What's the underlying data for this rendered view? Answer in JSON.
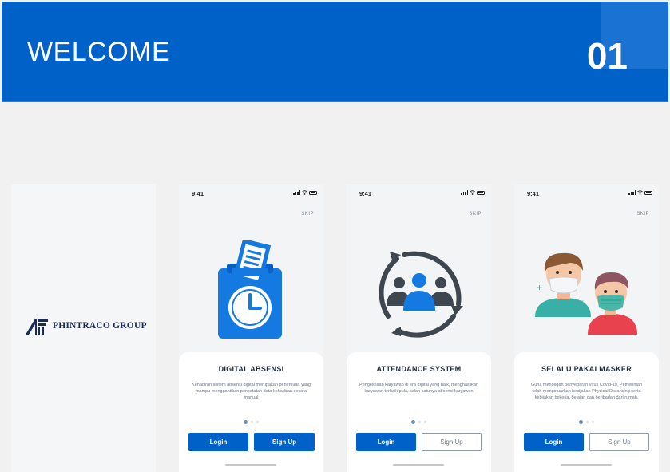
{
  "banner": {
    "title": "WELCOME",
    "number": "01"
  },
  "splash": {
    "brand": "PHINTRACO GROUP"
  },
  "screens": [
    {
      "time": "9:41",
      "skip": "SKIP",
      "title": "DIGITAL ABSENSI",
      "desc": "Kehadiran sistem absensi digital merupakan penemuan yang mampu menggantikan pencatatan data kehadiran secara manual",
      "login": "Login",
      "signup": "Sign Up",
      "illustration": "clock-card-icon"
    },
    {
      "time": "9:41",
      "skip": "SKIP",
      "title": "ATTENDANCE SYSTEM",
      "desc": "Pengelolaan karyawan di era digital yang baik, menghasilkan karyawan terbaik pula, salah satunya absensi karyawan",
      "login": "Login",
      "signup": "Sign Up",
      "illustration": "team-cycle-icon"
    },
    {
      "time": "9:41",
      "skip": "SKIP",
      "title": "SELALU PAKAI MASKER",
      "desc": "Guna mencegah penyebaran virus Covid-19, Pemerintah telah mengeluarkan kebijakan Physical Distancing serta kebijakan bekerja, belajar, dan beribadah dari rumah.",
      "login": "Login",
      "signup": "Sign Up",
      "illustration": "masked-people-icon"
    }
  ],
  "colors": {
    "primary": "#0061c9",
    "background": "#f1f1f2",
    "card": "#ffffff"
  }
}
